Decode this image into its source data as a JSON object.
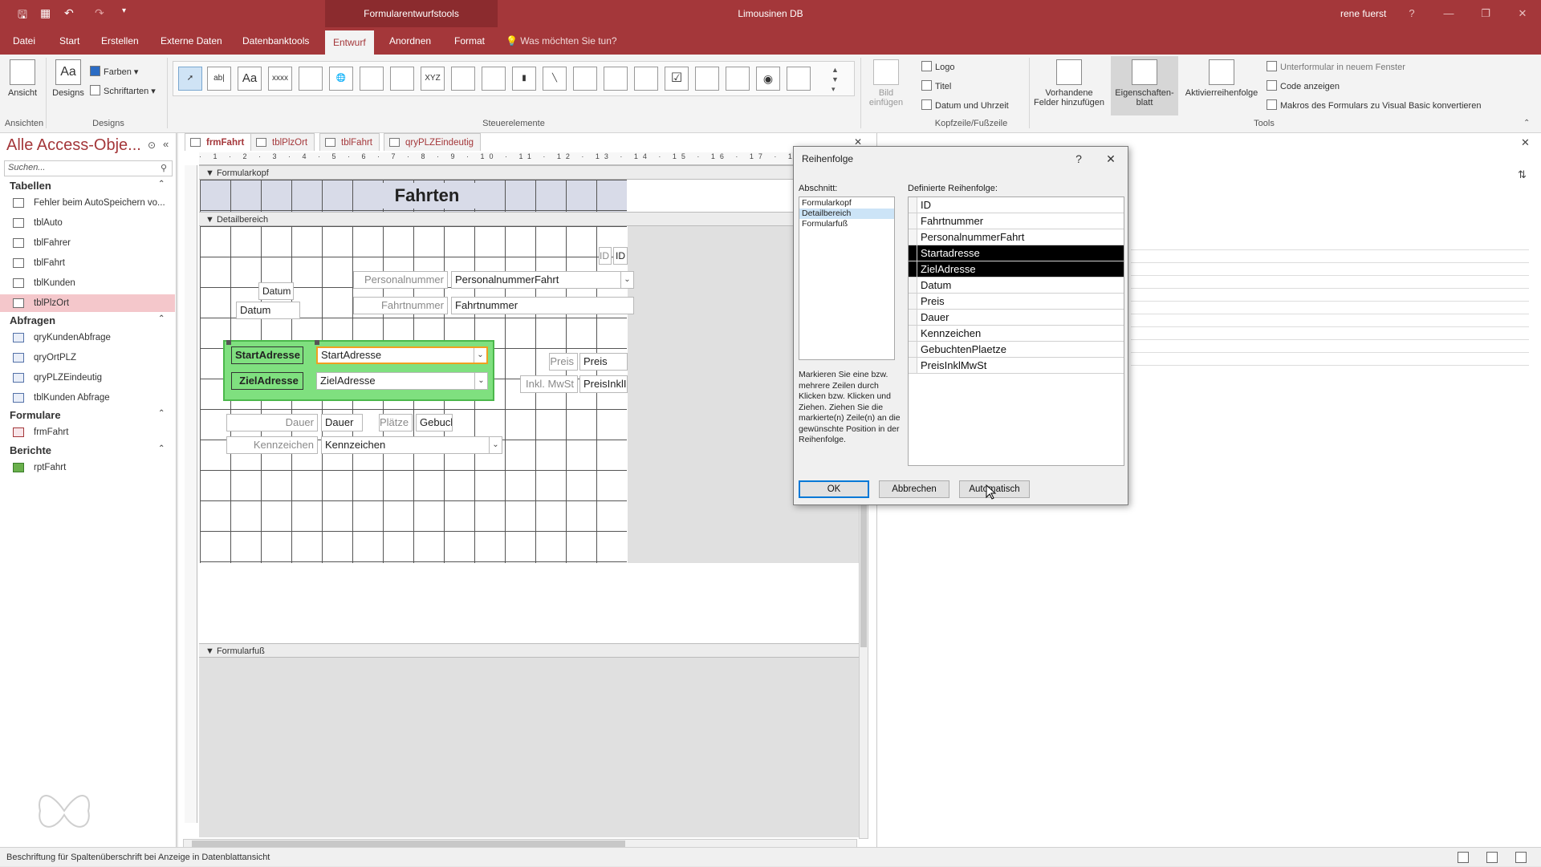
{
  "window": {
    "context_tools": "Formularentwurfstools",
    "app_title": "Limousinen DB",
    "user": "rene fuerst",
    "help_glyph": "?",
    "min_glyph": "—",
    "restore_glyph": "❐",
    "close_glyph": "✕"
  },
  "ribbon_tabs": [
    "Datei",
    "Start",
    "Erstellen",
    "Externe Daten",
    "Datenbanktools",
    "Entwurf",
    "Anordnen",
    "Format"
  ],
  "tell_me": "Was möchten Sie tun?",
  "ribbon": {
    "ansicht": "Ansicht",
    "designs": "Designs",
    "farben": "Farben",
    "schriftarten": "Schriftarten",
    "grp_ansichten": "Ansichten",
    "grp_designs": "Designs",
    "grp_steuerelemente": "Steuerelemente",
    "gallery_items": [
      "",
      "ab|",
      "Aa",
      "xxxx",
      "",
      "",
      "",
      "",
      "XYZ",
      "",
      "",
      "",
      "",
      "",
      "",
      "",
      "",
      "",
      "",
      "",
      "",
      ""
    ],
    "bild_einfuegen": "Bild einfügen",
    "logo": "Logo",
    "titel": "Titel",
    "datum_uhrzeit": "Datum und Uhrzeit",
    "grp_kopf": "Kopfzeile/Fußzeile",
    "vorhandene_felder": "Vorhandene Felder hinzufügen",
    "eigenschaftenblatt": "Eigenschaften-blatt",
    "aktivierreihenfolge": "Aktivierreihenfolge",
    "unterformular": "Unterformular in neuem Fenster",
    "code_anzeigen": "Code anzeigen",
    "makros": "Makros des Formulars zu Visual Basic konvertieren",
    "grp_tools": "Tools"
  },
  "nav": {
    "title": "Alle Access-Obje...",
    "search_placeholder": "Suchen...",
    "categories": [
      {
        "name": "Tabellen",
        "items": [
          "Fehler beim AutoSpeichern vo...",
          "tblAuto",
          "tblFahrer",
          "tblFahrt",
          "tblKunden",
          "tblPlzOrt"
        ]
      },
      {
        "name": "Abfragen",
        "items": [
          "qryKundenAbfrage",
          "qryOrtPLZ",
          "qryPLZEindeutig",
          "tblKunden Abfrage"
        ]
      },
      {
        "name": "Formulare",
        "items": [
          "frmFahrt"
        ]
      },
      {
        "name": "Berichte",
        "items": [
          "rptFahrt"
        ]
      }
    ]
  },
  "doc_tabs": [
    "frmFahrt",
    "tblPlzOrt",
    "tblFahrt",
    "qryPLZEindeutig"
  ],
  "doc_close": "✕",
  "form": {
    "ruler_marks": "· 1 · 2 · 3 · 4 · 5 · 6 · 7 · 8 · 9 · 10 · 11 · 12 · 13 · 14 · 15 · 16 · 17 · 18 · 19",
    "section_header": "Formularkopf",
    "section_detail": "Detailbereich",
    "section_footer": "Formularfuß",
    "title": "Fahrten",
    "controls": {
      "id_label": "ID",
      "id_field": "ID",
      "datum_label": "Datum",
      "datum_field": "Datum",
      "personal_label": "Personalnummer",
      "personal_field": "PersonalnummerFahrt",
      "fahrt_label": "Fahrtnummer",
      "fahrt_field": "Fahrtnummer",
      "start_label": "StartAdresse",
      "start_field": "StartAdresse",
      "ziel_label": "ZielAdresse",
      "ziel_field": "ZielAdresse",
      "preis_label": "Preis",
      "preis_field": "Preis",
      "mwst_label": "Inkl. MwSt",
      "mwst_field": "PreisInklI",
      "dauer_label": "Dauer",
      "dauer_field": "Dauer",
      "plaetze_label": "Plätze",
      "plaetze_field": "Gebucl",
      "kenn_label": "Kennzeichen",
      "kenn_field": "Kennzeichen"
    }
  },
  "dialog": {
    "title": "Reihenfolge",
    "help": "?",
    "close": "✕",
    "section_label": "Abschnitt:",
    "sections": [
      "Formularkopf",
      "Detailbereich",
      "Formularfuß"
    ],
    "order_label": "Definierte Reihenfolge:",
    "order": [
      "ID",
      "Fahrtnummer",
      "PersonalnummerFahrt",
      "Startadresse",
      "ZielAdresse",
      "Datum",
      "Preis",
      "Dauer",
      "Kennzeichen",
      "GebuchtenPlaetze",
      "PreisInklMwSt"
    ],
    "help_text": "Markieren Sie eine bzw. mehrere Zeilen durch Klicken bzw. Klicken und Ziehen. Ziehen Sie die markierte(n) Zeile(n) an die gewünschte Position in der Reihenfolge.",
    "ok": "OK",
    "cancel": "Abbrechen",
    "auto": "Automatisch"
  },
  "status": "Beschriftung für Spaltenüberschrift bei Anzeige in Datenblattansicht",
  "colors": {
    "accent": "#a4373a",
    "selection": "#f4c7cb",
    "highlight_group": "#7fe07f"
  }
}
